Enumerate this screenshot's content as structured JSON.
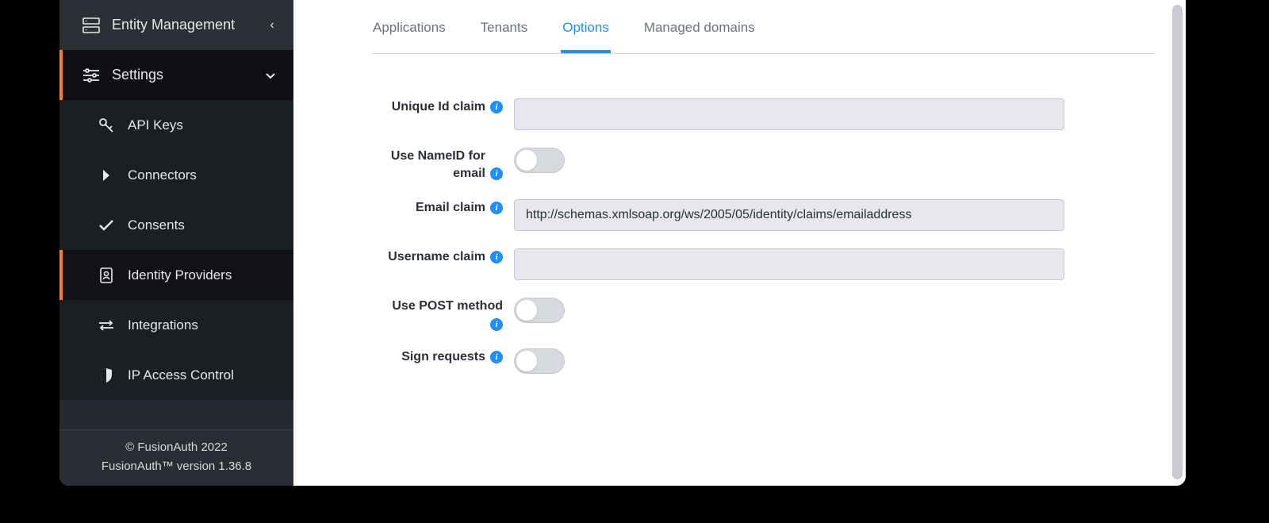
{
  "sidebar": {
    "entity_management_label": "Entity Management",
    "settings_label": "Settings",
    "items": [
      {
        "label": "API Keys"
      },
      {
        "label": "Connectors"
      },
      {
        "label": "Consents"
      },
      {
        "label": "Identity Providers"
      },
      {
        "label": "Integrations"
      },
      {
        "label": "IP Access Control"
      }
    ],
    "copyright": "© FusionAuth 2022",
    "version": "FusionAuth™ version 1.36.8"
  },
  "tabs": [
    {
      "label": "Applications",
      "active": false
    },
    {
      "label": "Tenants",
      "active": false
    },
    {
      "label": "Options",
      "active": true
    },
    {
      "label": "Managed domains",
      "active": false
    }
  ],
  "form": {
    "unique_id_claim": {
      "label": "Unique Id claim",
      "value": ""
    },
    "use_nameid_email": {
      "label": "Use NameID for email",
      "value": false
    },
    "email_claim": {
      "label": "Email claim",
      "value": "http://schemas.xmlsoap.org/ws/2005/05/identity/claims/emailaddress"
    },
    "username_claim": {
      "label": "Username claim",
      "value": ""
    },
    "use_post_method": {
      "label": "Use POST method",
      "value": false
    },
    "sign_requests": {
      "label": "Sign requests",
      "value": false
    }
  }
}
